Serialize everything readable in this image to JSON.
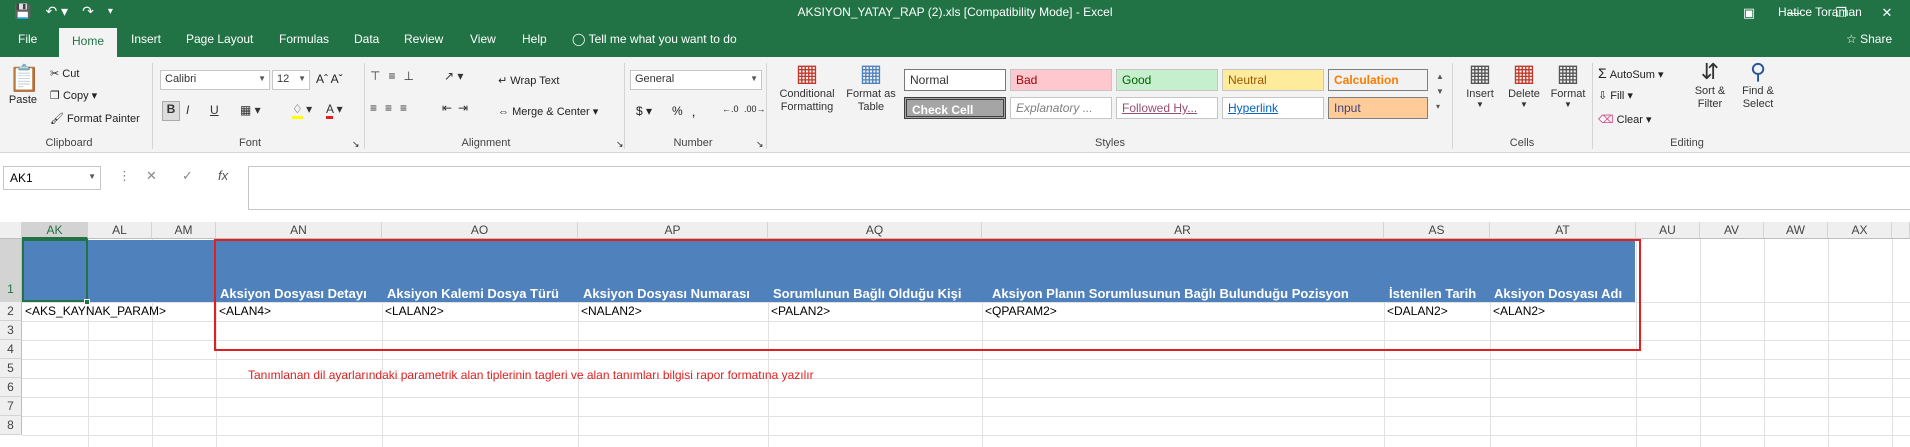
{
  "window": {
    "title": "AKSIYON_YATAY_RAP (2).xls  [Compatibility Mode]  -  Excel",
    "user": "Hatice Toraman"
  },
  "tabs": [
    "File",
    "Home",
    "Insert",
    "Page Layout",
    "Formulas",
    "Data",
    "Review",
    "View",
    "Help",
    "Tell me what you want to do",
    "Share"
  ],
  "ribbon": {
    "clipboard": {
      "paste": "Paste",
      "cut": "Cut",
      "copy": "Copy",
      "format_painter": "Format Painter",
      "label": "Clipboard"
    },
    "font": {
      "name": "Calibri",
      "size": "12",
      "bold": "B",
      "italic": "I",
      "underline": "U",
      "label": "Font"
    },
    "alignment": {
      "wrap": "Wrap Text",
      "merge": "Merge & Center",
      "label": "Alignment"
    },
    "number": {
      "format": "General",
      "label": "Number"
    },
    "styles": {
      "conditional": "Conditional Formatting",
      "format_table": "Format as Table",
      "normal": "Normal",
      "bad": "Bad",
      "good": "Good",
      "neutral": "Neutral",
      "calculation": "Calculation",
      "check_cell": "Check Cell",
      "explanatory": "Explanatory ...",
      "followed": "Followed Hy...",
      "hyperlink": "Hyperlink",
      "input": "Input",
      "label": "Styles"
    },
    "cells": {
      "insert": "Insert",
      "delete": "Delete",
      "format": "Format",
      "label": "Cells"
    },
    "editing": {
      "autosum": "AutoSum",
      "fill": "Fill",
      "clear": "Clear",
      "sort": "Sort & Filter",
      "find": "Find & Select",
      "label": "Editing"
    }
  },
  "formula": {
    "namebox": "AK1",
    "fx": "fx",
    "value": ""
  },
  "grid": {
    "columns": [
      "AK",
      "AL",
      "AM",
      "AN",
      "AO",
      "AP",
      "AQ",
      "AR",
      "AS",
      "AT",
      "AU",
      "AV",
      "AW",
      "AX"
    ],
    "rows": [
      "1",
      "2",
      "3",
      "4",
      "5",
      "6",
      "7",
      "8"
    ],
    "row1": [
      "Aksiyon Dosyası Detayı",
      "Aksiyon Kalemi Dosya Türü",
      "Aksiyon Dosyası Numarası",
      "Sorumlunun Bağlı Olduğu Kişi",
      "Aksiyon Planın Sorumlusunun Bağlı Bulunduğu Pozisyon",
      "İstenilen Tarih",
      "Aksiyon Dosyası Adı"
    ],
    "row2": [
      "<AKS_KAYNAK_PARAM>",
      "<ALAN4>",
      "<LALAN2>",
      "<NALAN2>",
      "<PALAN2>",
      "<QPARAM2>",
      "<DALAN2>",
      "<ALAN2>"
    ]
  },
  "note": "Tanımlanan dil ayarlarındaki parametrik alan tiplerinin tagleri ve alan tanımları bilgisi rapor formatına yazılır",
  "colors": {
    "excel_green": "#217346",
    "header_blue": "#4f81bd",
    "annotation_red": "#e02020"
  }
}
